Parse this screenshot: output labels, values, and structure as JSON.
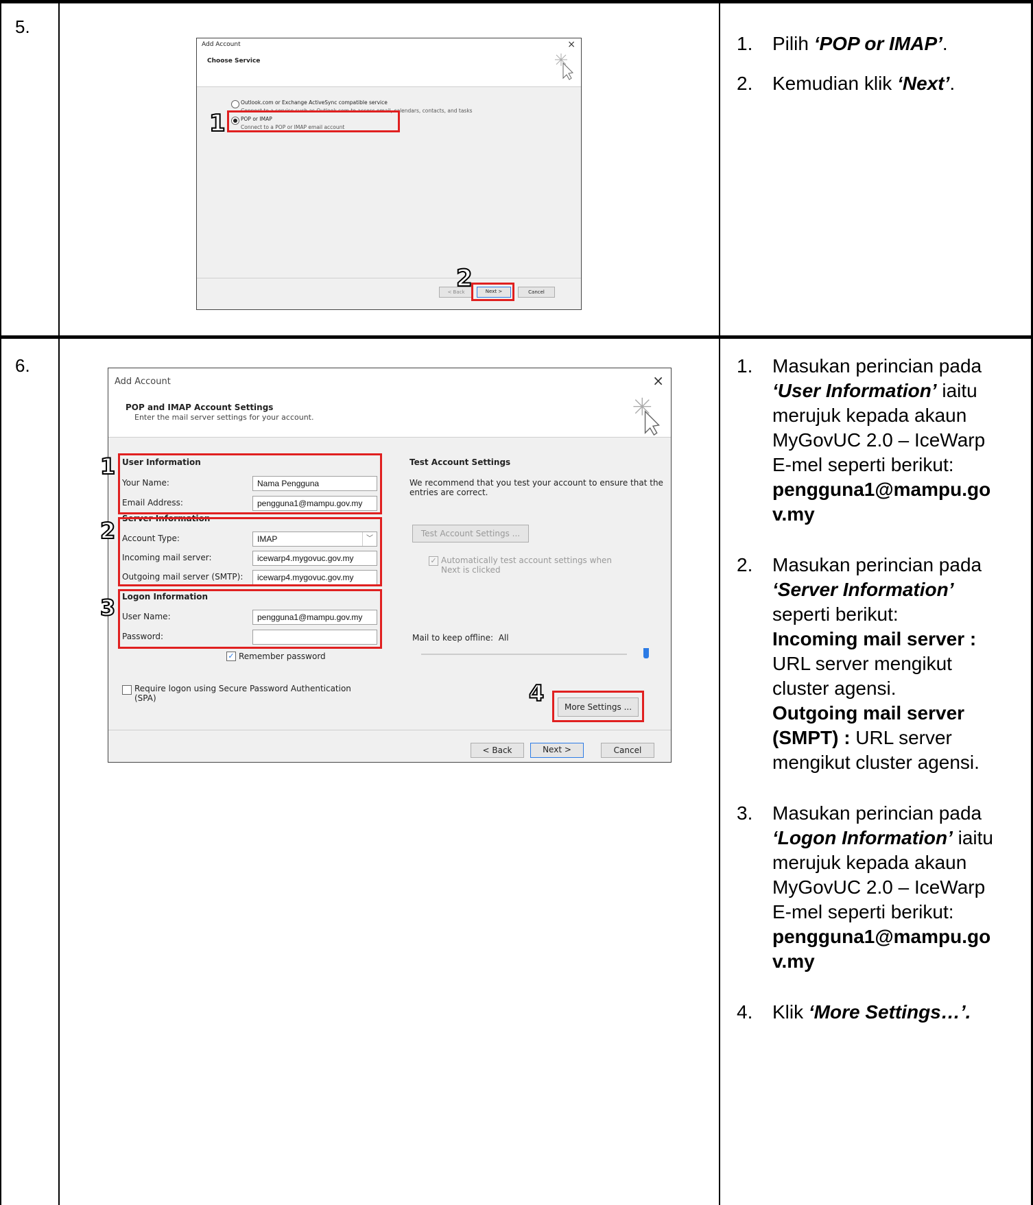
{
  "rows": [
    {
      "number": "5.",
      "dialog": {
        "title": "Add Account",
        "close": "×",
        "heading": "Choose Service",
        "option1_label": "Outlook.com or Exchange ActiveSync compatible service",
        "option1_desc": "Connect to a service such as Outlook.com to access email, calendars, contacts, and tasks",
        "option2_label": "POP or IMAP",
        "option2_desc": "Connect to a POP or IMAP email account",
        "back_label": "< Back",
        "next_label": "Next >",
        "cancel_label": "Cancel",
        "marker1": "1",
        "marker2": "2"
      },
      "instructions": [
        {
          "n": "1.",
          "pre": "Pilih ",
          "bold": "‘POP or IMAP’",
          "post": "."
        },
        {
          "n": "2.",
          "pre": "Kemudian klik ",
          "bold": "‘Next’",
          "post": "."
        }
      ]
    },
    {
      "number": "6.",
      "dialog": {
        "title": "Add Account",
        "close": "×",
        "heading": "POP and IMAP Account Settings",
        "subheading": "Enter the mail server settings for your account.",
        "user_info_header": "User Information",
        "your_name_label": "Your Name:",
        "your_name_value": "Nama Pengguna",
        "email_label": "Email Address:",
        "email_value": "pengguna1@mampu.gov.my",
        "server_info_header": "Server Information",
        "account_type_label": "Account Type:",
        "account_type_value": "IMAP",
        "incoming_label": "Incoming mail server:",
        "incoming_value": "icewarp4.mygovuc.gov.my",
        "outgoing_label": "Outgoing mail server (SMTP):",
        "outgoing_value": "icewarp4.mygovuc.gov.my",
        "logon_header": "Logon Information",
        "username_label": "User Name:",
        "username_value": "pengguna1@mampu.gov.my",
        "password_label": "Password:",
        "remember_label": "Remember password",
        "spa_label": "Require logon using Secure Password Authentication (SPA)",
        "test_header": "Test Account Settings",
        "test_desc": "We recommend that you test your account to ensure that the entries are correct.",
        "test_button": "Test Account Settings ...",
        "auto_test_label": "Automatically test account settings when Next is clicked",
        "offline_label": "Mail to keep offline:",
        "offline_value": "All",
        "more_settings": "More Settings ...",
        "back_label": "< Back",
        "next_label": "Next >",
        "cancel_label": "Cancel",
        "marker1": "1",
        "marker2": "2",
        "marker3": "3",
        "marker4": "4"
      },
      "instructions": {
        "i1": {
          "n": "1.",
          "a": "Masukan perincian pada ",
          "b": "‘User Information’",
          "c": " iaitu merujuk kepada akaun MyGovUC 2.0 – IceWarp E-mel seperti berikut:",
          "d": "pengguna1@mampu.gov.my"
        },
        "i2": {
          "n": "2.",
          "a": "Masukan perincian pada ",
          "b": "‘Server Information’",
          "c": " seperti berikut:",
          "d1": "Incoming mail server :",
          "e1": " URL server mengikut cluster agensi.",
          "d2": "Outgoing mail server (SMPT) :",
          "e2": " URL server mengikut cluster agensi."
        },
        "i3": {
          "n": "3.",
          "a": "Masukan perincian pada ",
          "b": "‘Logon Information’",
          "c": " iaitu merujuk kepada akaun MyGovUC 2.0 – IceWarp E-mel seperti berikut:",
          "d": "pengguna1@mampu.gov.my"
        },
        "i4": {
          "n": "4.",
          "a": "Klik ",
          "b": "‘More Settings…’."
        }
      }
    }
  ]
}
